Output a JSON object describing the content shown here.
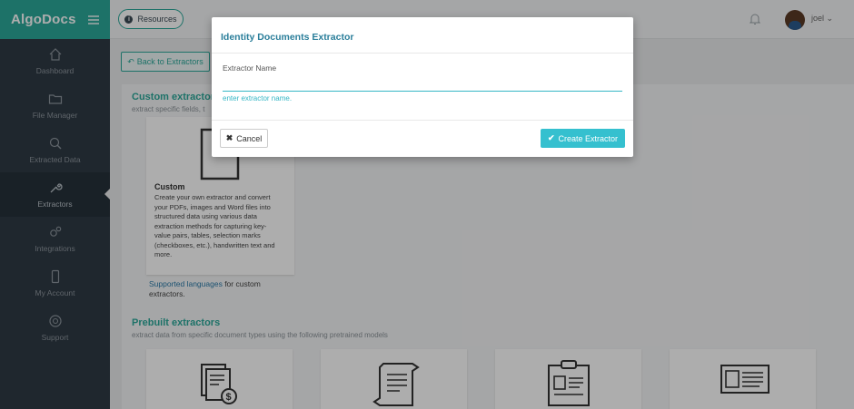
{
  "brand": {
    "name": "AlgoDocs"
  },
  "sidebar": {
    "items": [
      {
        "label": "Dashboard",
        "icon": "home-icon"
      },
      {
        "label": "File Manager",
        "icon": "folder-icon"
      },
      {
        "label": "Extracted Data",
        "icon": "search-icon"
      },
      {
        "label": "Extractors",
        "icon": "wrench-icon",
        "active": true
      },
      {
        "label": "Integrations",
        "icon": "gears-icon"
      },
      {
        "label": "My Account",
        "icon": "phone-icon"
      },
      {
        "label": "Support",
        "icon": "lifebuoy-icon"
      }
    ]
  },
  "topbar": {
    "resources_label": "Resources",
    "user_name": "joel"
  },
  "main": {
    "back_label": "Back to Extractors",
    "custom_section": {
      "title": "Custom extractor",
      "subtitle": "extract specific fields, t",
      "card_title": "Custom",
      "card_desc": "Create your own extractor and convert your PDFs, images and Word files into structured data using various data extraction methods for capturing key-value pairs, tables, selection marks (checkboxes, etc.), handwritten text and more.",
      "lang_link": "Supported languages",
      "lang_rest": " for custom extractors."
    },
    "prebuilt_section": {
      "title": "Prebuilt extractors",
      "subtitle": "extract data from specific document types using the following pretrained models"
    }
  },
  "modal": {
    "title": "Identity Documents Extractor",
    "field_label": "Extractor Name",
    "field_value": "",
    "field_hint": "enter extractor name.",
    "cancel_label": "Cancel",
    "create_label": "Create Extractor"
  },
  "colors": {
    "accent": "#2ca89a",
    "sidebar_bg": "#2f3a44",
    "primary_button": "#35c0cf",
    "modal_title": "#2a7e9a"
  }
}
